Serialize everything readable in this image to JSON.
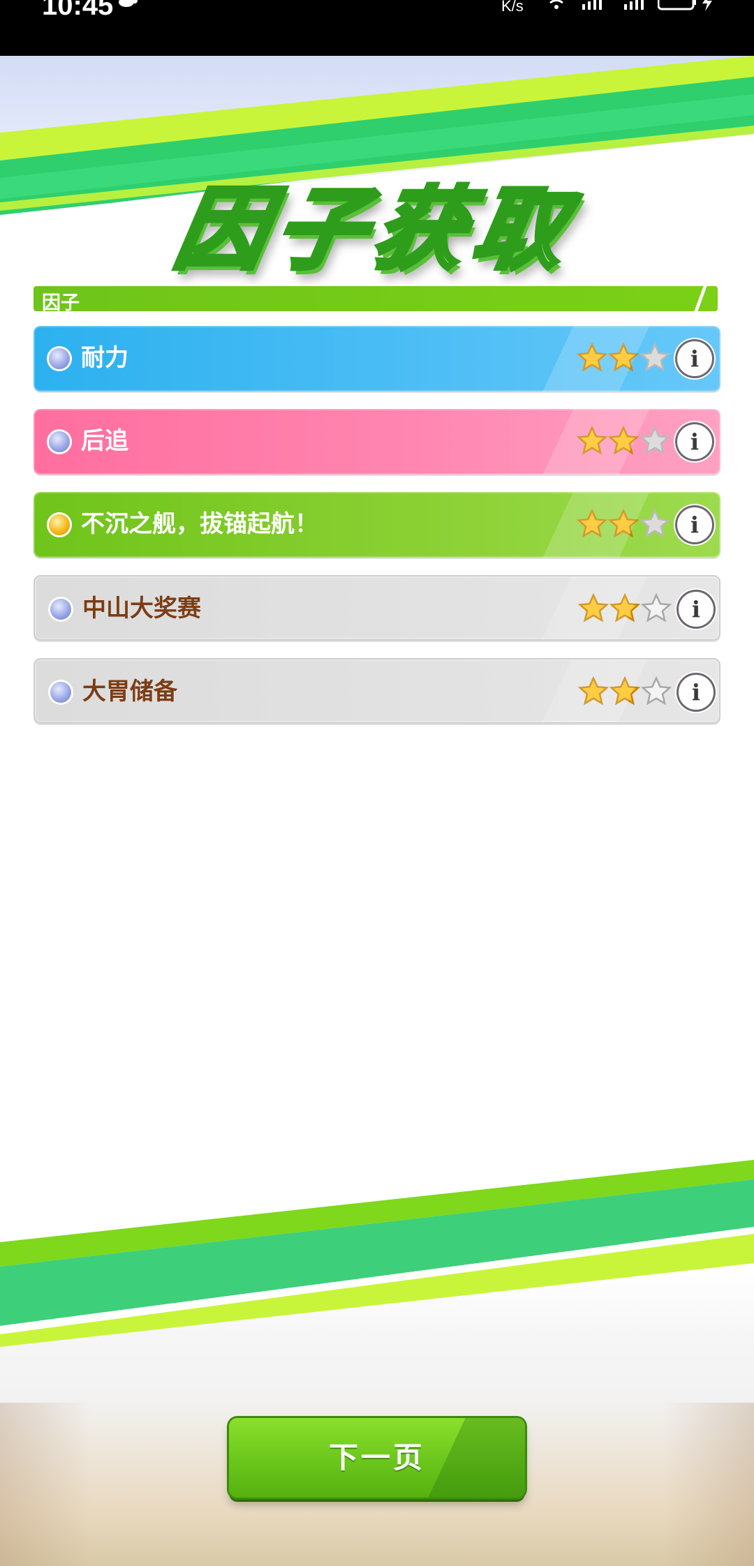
{
  "status_bar": {
    "time": "10:45",
    "speed": "K/s"
  },
  "header": {
    "title": "因子获取"
  },
  "section": {
    "title": "因子"
  },
  "factors": [
    {
      "name": "耐力",
      "color": "#2cb1ef",
      "stars_filled": 2,
      "stars_total": 3,
      "info": "i"
    },
    {
      "name": "后追",
      "color": "#ff6e9f",
      "stars_filled": 2,
      "stars_total": 3,
      "info": "i"
    },
    {
      "name": "不沉之舰，拔锚起航！",
      "color": "#6fc41a",
      "stars_filled": 2,
      "stars_total": 3,
      "info": "i"
    },
    {
      "name": "中山大奖赛",
      "color": "#dcdcdc",
      "stars_filled": 2,
      "stars_total": 3,
      "info": "i"
    },
    {
      "name": "大胃储备",
      "color": "#dcdcdc",
      "stars_filled": 2,
      "stars_total": 3,
      "info": "i"
    }
  ],
  "footer": {
    "next_label": "下一页"
  }
}
